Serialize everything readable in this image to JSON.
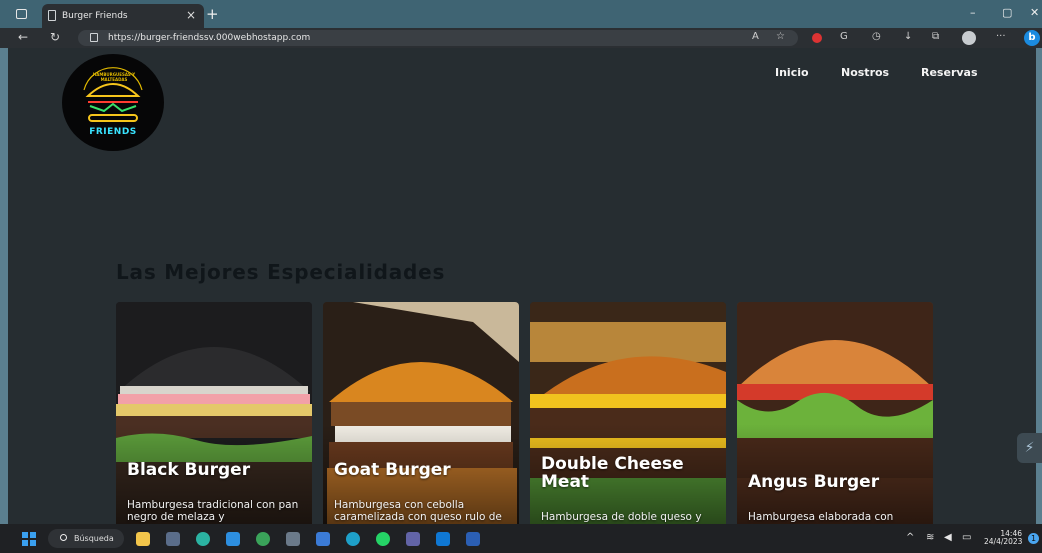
{
  "browser": {
    "tab_title": "Burger Friends",
    "url": "https://burger-friendssv.000webhostapp.com"
  },
  "site": {
    "logo": {
      "top_text": "HAMBURGUESAS Y MALTEADAS",
      "bottom_text": "FRIENDS"
    },
    "nav": [
      "Inicio",
      "Nostros",
      "Reservas"
    ],
    "section_title": "Las Mejores Especialidades",
    "cards": [
      {
        "name": "Black Burger",
        "desc": "Hamburgesa tradicional con pan negro de melaza y"
      },
      {
        "name": "Goat Burger",
        "desc": "Hamburgesa con cebolla caramelizada con queso rulo de"
      },
      {
        "name": "Double Cheese Meat",
        "desc": "Hamburgesa de doble queso y"
      },
      {
        "name": "Angus Burger",
        "desc": "Hamburgesa elaborada con"
      }
    ]
  },
  "taskbar": {
    "search_label": "Búsqueda",
    "time": "14:46",
    "date": "24/4/2023"
  }
}
